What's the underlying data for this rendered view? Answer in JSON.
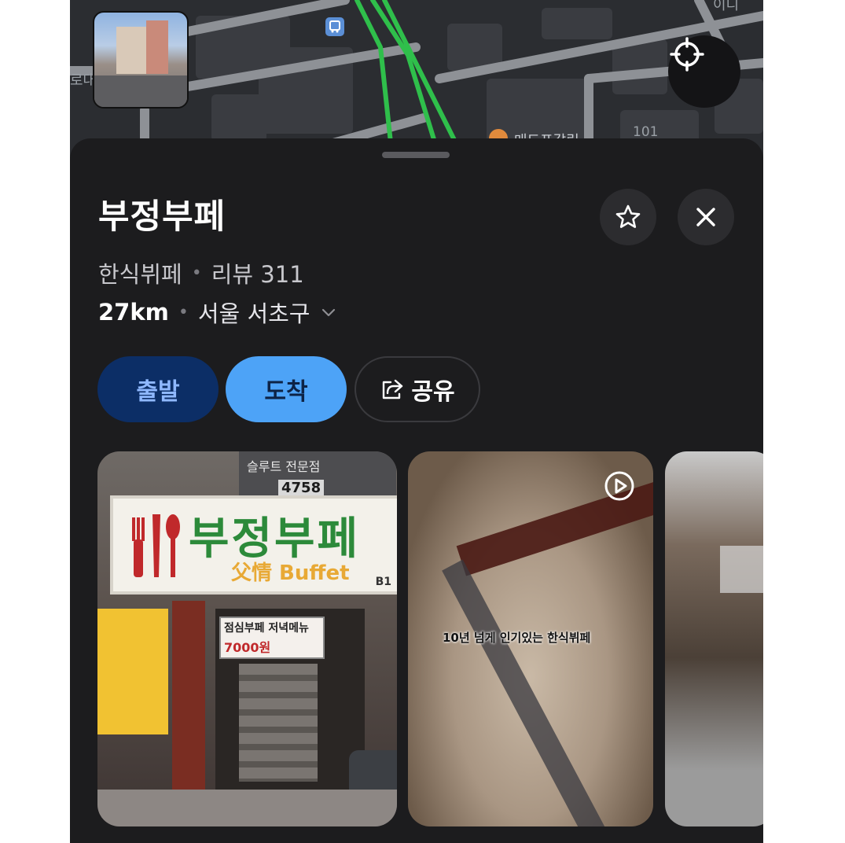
{
  "map": {
    "left_label": "로대",
    "poi_label": "매드포갈릭",
    "building_number": "101",
    "top_right_label": "이디"
  },
  "place": {
    "name": "부정부페",
    "category": "한식뷔페",
    "review_label": "리뷰 311",
    "distance": "27km",
    "region": "서울 서초구"
  },
  "actions": {
    "depart": "출발",
    "arrive": "도착",
    "share": "공유"
  },
  "photos": [
    {
      "sign_name": "부정부페",
      "sign_sub": "父情 Buffet",
      "sign_floor": "B1",
      "upper_sign": "슬루트 전문점",
      "building_no": "4758",
      "lunch_line1": "점심부페 저녁메뉴",
      "lunch_line2": "7000원"
    },
    {
      "caption": "10년 넘게 인기있는 한식뷔페"
    },
    {}
  ],
  "colors": {
    "depart_bg": "#0c2e66",
    "arrive_bg": "#4da3f7",
    "sheet_bg": "#1c1c1e",
    "route": "#2fbf4b"
  },
  "icons": [
    "bus-stop-icon",
    "locate-icon",
    "star-icon",
    "close-icon",
    "chevron-down-icon",
    "share-icon",
    "video-play-icon"
  ]
}
